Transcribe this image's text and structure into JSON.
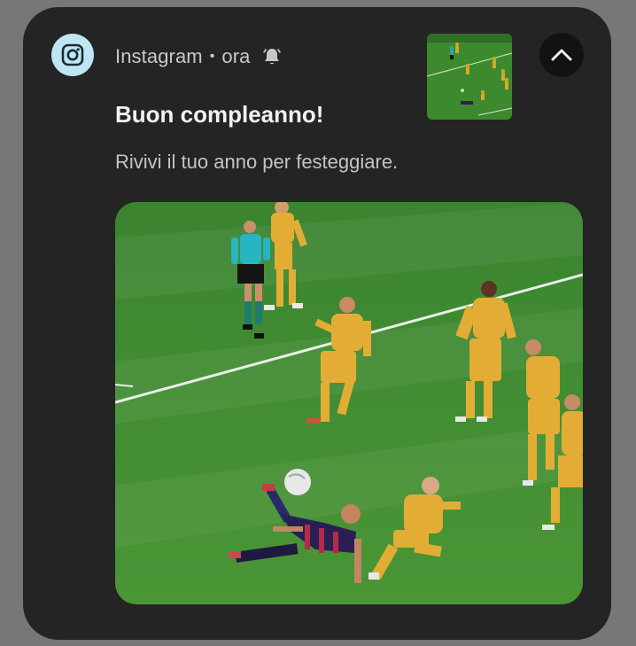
{
  "notification": {
    "app_name": "Instagram",
    "separator": "•",
    "time": "ora",
    "app_icon": "instagram-icon",
    "alert_icon": "bell-icon",
    "collapse_icon": "chevron-up-icon",
    "title": "Buon compleanno!",
    "body": "Rivivi il tuo anno per festeggiare.",
    "image_description": "football-bicycle-kick-photo"
  },
  "colors": {
    "card_background": "#242424",
    "page_background": "#777779",
    "icon_background": "#bfe6f5",
    "pitch_green": "#3f8a2f"
  }
}
